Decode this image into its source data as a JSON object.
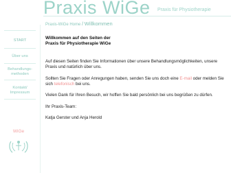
{
  "header": {
    "title": "Praxis WiGe",
    "subtitle": "Praxis für Physiotherapie"
  },
  "breadcrumb": {
    "root": "Praxis-WiGe Home",
    "separator": "/",
    "current": "Willkommen"
  },
  "sidebar": {
    "items": [
      {
        "label_1": "START",
        "label_2": ""
      },
      {
        "label_1": "Über uns",
        "label_2": ""
      },
      {
        "label_1": "Behandlungs-",
        "label_2": "methoden"
      },
      {
        "label_1": "Kontakt/",
        "label_2": "Impressum"
      }
    ],
    "logo_text": "WiGe"
  },
  "content": {
    "heading_1": "Willkommen auf den Seiten der",
    "heading_2": "Praxis für Physiotherapie WiGe",
    "para1": "Auf diesen Seiten finden Sie Informationen über unsere Behandlungsmöglichkeiten, unsere Praxis und natürlich über uns.",
    "para2_a": "Sollten Sie Fragen oder Anregungen haben, senden Sie uns doch eine ",
    "email_link": "E-mail",
    "para2_b": " oder melden Sie sich ",
    "phone_link": "telefonisch",
    "para2_c": " bei uns.",
    "para3": "Vielen Dank für Ihren Besuch, wir hoffen Sie bald persönlich bei uns begrüßen zu dürfen.",
    "team_label": "Ihr Praxis-Team:",
    "team_names": "Katja Gerster und Anja Herold"
  },
  "colors": {
    "accent": "#9cd3c8",
    "link_pink": "#f08f8f"
  }
}
